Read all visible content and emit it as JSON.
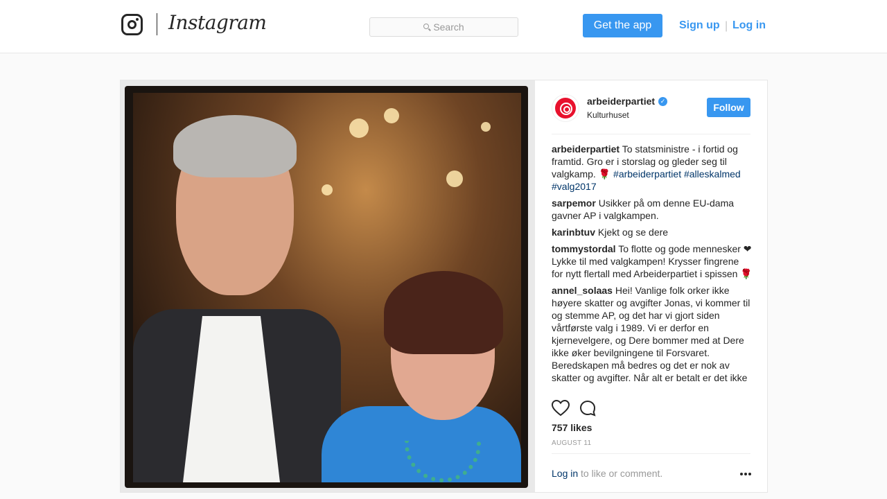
{
  "header": {
    "logo_text": "Instagram",
    "search_placeholder": "Search",
    "get_app_label": "Get the app",
    "signup_label": "Sign up",
    "separator": "|",
    "login_label": "Log in"
  },
  "post": {
    "username": "arbeiderpartiet",
    "location": "Kulturhuset",
    "follow_label": "Follow",
    "comments": [
      {
        "user": "arbeiderpartiet",
        "text": "To statsministre - i fortid og framtid. Gro er i storslag og gleder seg til valgkamp. 🌹 ",
        "tags": "#arbeiderpartiet #alleskalmed #valg2017"
      },
      {
        "user": "sarpemor",
        "text": "Usikker på om denne EU-dama gavner AP i valgkampen.",
        "tags": ""
      },
      {
        "user": "karinbtuv",
        "text": "Kjekt og se dere",
        "tags": ""
      },
      {
        "user": "tommystordal",
        "text": "To flotte og gode mennesker ❤ Lykke til med valgkampen! Krysser fingrene for nytt flertall med Arbeiderpartiet i spissen 🌹",
        "tags": ""
      },
      {
        "user": "annel_solaas",
        "text": "Hei! Vanlige folk orker ikke høyere skatter og avgifter Jonas, vi kommer til og stemme AP, og det har vi gjort siden vårtførste valg i 1989. Vi er derfor en kjernevelgere, og Dere bommer med at Dere ikke øker bevilgningene til Forsvaret. Beredskapen må bedres og det er nok av skatter og avgifter. Når alt er betalt er det ikke",
        "tags": ""
      }
    ],
    "likes": "757 likes",
    "date": "AUGUST 11",
    "footer_login": "Log in",
    "footer_text": " to like or comment."
  }
}
